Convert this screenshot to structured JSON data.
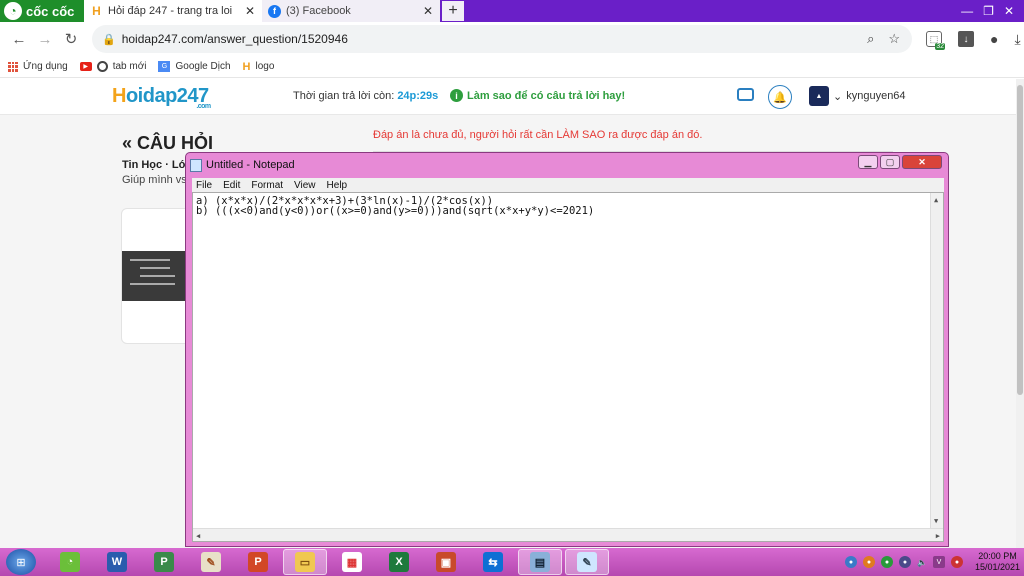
{
  "browser": {
    "brand": "cốc cốc",
    "tabs": [
      {
        "title": "Hỏi đáp 247 - trang tra loi",
        "active": true
      },
      {
        "title": "(3) Facebook",
        "active": false
      }
    ],
    "new_tab": "+",
    "url": "hoidap247.com/answer_question/1520946",
    "extension_badge": "32"
  },
  "bookmarks": [
    {
      "label": "Ứng dụng",
      "icon": "apps-grid-icon"
    },
    {
      "label": "tab mới",
      "icon": "youtube-icon"
    },
    {
      "label": "Google Dịch",
      "icon": "google-translate-icon"
    },
    {
      "label": "logo",
      "icon": "hoidap-logo-icon"
    }
  ],
  "site": {
    "logo_main": "oidap247",
    "logo_h": "H",
    "logo_suffix": ".com",
    "timer_label": "Thời gian trả lời còn:",
    "timer_value": "24p:29s",
    "howto": "Làm sao để có câu trả lời hay!",
    "username": "kynguyen64"
  },
  "question": {
    "heading": "« CÂU HỎI",
    "meta": "Tin Học · Lớp",
    "help": "Giúp mình vs",
    "warning": "Đáp án là chưa đủ, người hỏi rất cần LÀM SAO ra được đáp án đó."
  },
  "notepad": {
    "title": "Untitled - Notepad",
    "menu": [
      "File",
      "Edit",
      "Format",
      "View",
      "Help"
    ],
    "lines": [
      "a) (x*x*x)/(2*x*x*x*x+3)+(3*ln(x)-1)/(2*cos(x))",
      "b) (((x<0)and(y<0))or((x>=0)and(y>=0)))and(sqrt(x*x+y*y)<=2021)"
    ]
  },
  "taskbar": {
    "apps": [
      "coccoc",
      "word",
      "project",
      "paint",
      "powerpoint",
      "explorer",
      "apps",
      "excel",
      "photo",
      "teamviewer",
      "calculator",
      "notepad"
    ],
    "clock_time": "20:00 PM",
    "clock_date": "15/01/2021"
  },
  "colors": {
    "tabbar": "#6a1fc8",
    "notepad_frame": "#e78ad6",
    "taskbar": "#c95ac4",
    "site_blue": "#2196c8",
    "warning_red": "#e53935"
  }
}
